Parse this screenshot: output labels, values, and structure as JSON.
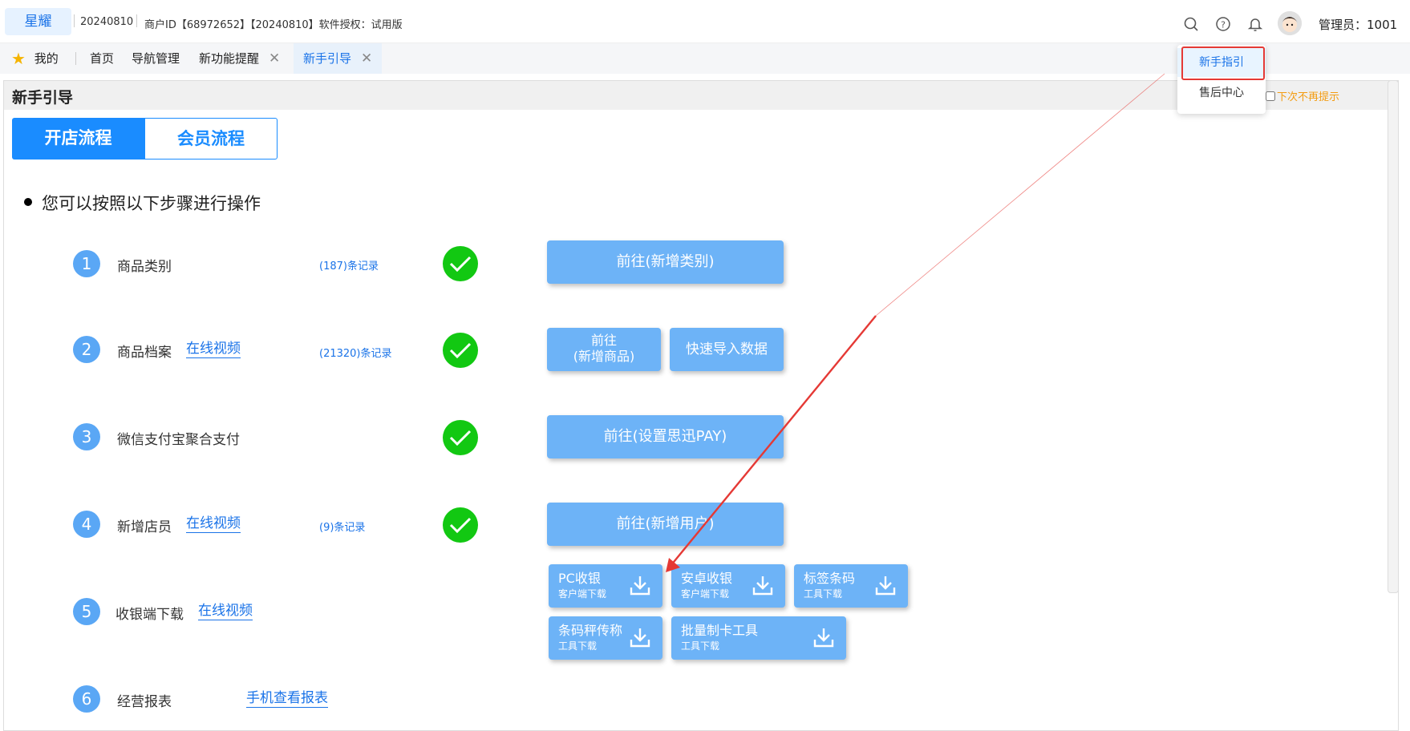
{
  "topbar": {
    "brand": "星耀",
    "date": "20240810",
    "merchant": "商户ID【68972652】【20240810】软件授权：试用版",
    "admin": "管理员：1001",
    "icons": [
      "search-icon",
      "help-icon",
      "bell-icon"
    ]
  },
  "tabs": [
    {
      "label": "我的",
      "icon": "star-icon"
    },
    {
      "label": "首页"
    },
    {
      "label": "导航管理"
    },
    {
      "label": "新功能提醒",
      "closable": true
    },
    {
      "label": "新手引导",
      "closable": true,
      "active": true
    }
  ],
  "panel": {
    "title": "新手引导",
    "segments": [
      "开店流程",
      "会员流程"
    ],
    "intro": "您可以按照以下步骤进行操作"
  },
  "steps": [
    {
      "num": "1",
      "label": "商品类别",
      "records": "(187)条记录",
      "done": true,
      "button": "前往(新增类别)"
    },
    {
      "num": "2",
      "label": "商品档案",
      "video": "在线视频",
      "records": "(21320)条记录",
      "done": true,
      "button_line1": "前往",
      "button_line2": "(新增商品)",
      "button2": "快速导入数据"
    },
    {
      "num": "3",
      "label": "微信支付宝聚合支付",
      "done": true,
      "button": "前往(设置思迅PAY)"
    },
    {
      "num": "4",
      "label": "新增店员",
      "video": "在线视频",
      "records": "(9)条记录",
      "done": true,
      "button": "前往(新增用户)"
    },
    {
      "num": "5",
      "label": "收银端下载",
      "video": "在线视频"
    },
    {
      "num": "6",
      "label": "经营报表",
      "video": "手机查看报表"
    }
  ],
  "downloads": [
    {
      "title": "PC收银",
      "sub": "客户端下载"
    },
    {
      "title": "安卓收银",
      "sub": "客户端下载"
    },
    {
      "title": "标签条码",
      "sub": "工具下载"
    },
    {
      "title": "条码秤传称",
      "sub": "工具下载"
    },
    {
      "title": "批量制卡工具",
      "sub": "工具下载"
    }
  ],
  "dropdown": {
    "items": [
      "新手指引",
      "售后中心"
    ],
    "no_more": "下次不再提示"
  },
  "colors": {
    "accent": "#1a8cff",
    "button": "#6db3f7",
    "check": "#12c812",
    "highlight": "#e53935"
  }
}
